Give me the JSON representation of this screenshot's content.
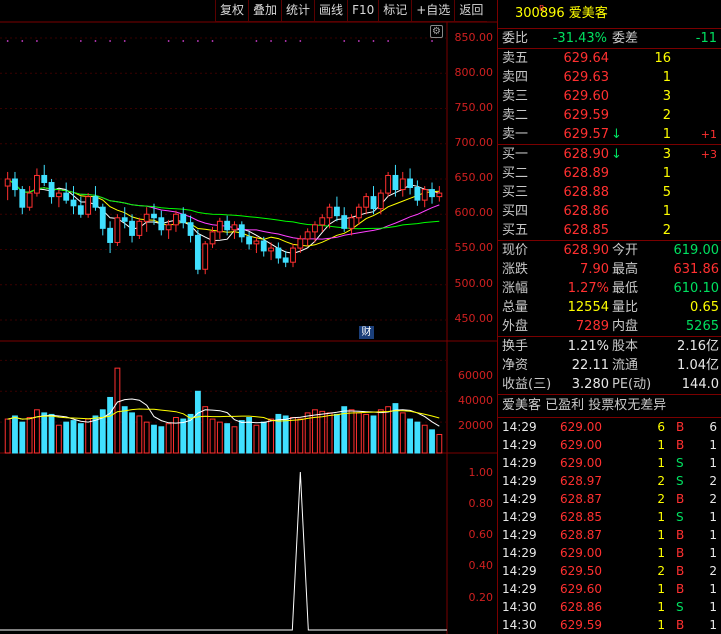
{
  "toolbar": [
    "复权",
    "叠加",
    "统计",
    "画线",
    "F10",
    "标记",
    "+自选",
    "返回"
  ],
  "price_axis": [
    "850.00",
    "800.00",
    "750.00",
    "700.00",
    "650.00",
    "600.00",
    "550.00",
    "500.00",
    "450.00"
  ],
  "volume_axis": [
    "60000",
    "40000",
    "20000"
  ],
  "indicator_axis": [
    "1.00",
    "0.80",
    "0.60",
    "0.40",
    "0.20"
  ],
  "event_badge": "财",
  "colors": {
    "up": "#ff3030",
    "down": "#40e0ff",
    "ma5": "#ffffff",
    "ma10": "#ffff00",
    "ma20": "#ff40ff",
    "ma60": "#00ff00",
    "frame": "#7a0000"
  },
  "candles": [
    [
      640,
      660,
      620,
      650
    ],
    [
      650,
      660,
      625,
      635
    ],
    [
      635,
      640,
      600,
      610
    ],
    [
      610,
      640,
      605,
      630
    ],
    [
      630,
      665,
      625,
      655
    ],
    [
      655,
      670,
      640,
      645
    ],
    [
      645,
      650,
      615,
      625
    ],
    [
      625,
      635,
      610,
      630
    ],
    [
      630,
      645,
      615,
      620
    ],
    [
      620,
      640,
      600,
      612
    ],
    [
      612,
      625,
      595,
      600
    ],
    [
      600,
      630,
      595,
      625
    ],
    [
      625,
      640,
      605,
      610
    ],
    [
      610,
      615,
      570,
      580
    ],
    [
      580,
      590,
      545,
      560
    ],
    [
      560,
      600,
      555,
      595
    ],
    [
      595,
      610,
      580,
      590
    ],
    [
      590,
      600,
      560,
      570
    ],
    [
      570,
      595,
      565,
      590
    ],
    [
      590,
      610,
      575,
      600
    ],
    [
      600,
      615,
      585,
      595
    ],
    [
      595,
      605,
      570,
      578
    ],
    [
      578,
      592,
      565,
      585
    ],
    [
      585,
      605,
      575,
      600
    ],
    [
      600,
      610,
      580,
      588
    ],
    [
      588,
      598,
      560,
      570
    ],
    [
      570,
      578,
      515,
      522
    ],
    [
      522,
      562,
      515,
      558
    ],
    [
      558,
      582,
      552,
      575
    ],
    [
      575,
      595,
      565,
      590
    ],
    [
      590,
      598,
      570,
      578
    ],
    [
      578,
      590,
      565,
      585
    ],
    [
      585,
      590,
      560,
      568
    ],
    [
      568,
      575,
      550,
      558
    ],
    [
      558,
      568,
      545,
      562
    ],
    [
      562,
      568,
      540,
      548
    ],
    [
      548,
      560,
      535,
      552
    ],
    [
      552,
      560,
      530,
      538
    ],
    [
      538,
      548,
      525,
      532
    ],
    [
      532,
      558,
      525,
      552
    ],
    [
      552,
      570,
      545,
      565
    ],
    [
      565,
      580,
      555,
      575
    ],
    [
      575,
      590,
      560,
      585
    ],
    [
      585,
      600,
      575,
      595
    ],
    [
      595,
      615,
      580,
      610
    ],
    [
      610,
      625,
      590,
      598
    ],
    [
      598,
      610,
      575,
      580
    ],
    [
      580,
      600,
      570,
      595
    ],
    [
      595,
      615,
      585,
      610
    ],
    [
      610,
      630,
      600,
      625
    ],
    [
      625,
      640,
      600,
      608
    ],
    [
      608,
      635,
      600,
      630
    ],
    [
      630,
      660,
      625,
      655
    ],
    [
      655,
      670,
      625,
      635
    ],
    [
      635,
      660,
      625,
      650
    ],
    [
      650,
      665,
      628,
      638
    ],
    [
      638,
      648,
      612,
      620
    ],
    [
      620,
      640,
      610,
      635
    ],
    [
      635,
      645,
      615,
      625
    ],
    [
      625,
      640,
      618,
      630
    ]
  ],
  "volumes": [
    22000,
    24000,
    20000,
    23000,
    28000,
    26000,
    25000,
    18000,
    20000,
    21000,
    19000,
    22000,
    24000,
    28000,
    36000,
    55000,
    30000,
    26000,
    24000,
    20000,
    18000,
    17000,
    19000,
    23000,
    22000,
    25000,
    40000,
    30000,
    22000,
    20000,
    19000,
    17000,
    21000,
    23000,
    18000,
    20000,
    22000,
    25000,
    24000,
    23000,
    22000,
    26000,
    28000,
    27000,
    26000,
    25000,
    30000,
    28000,
    26000,
    25000,
    24000,
    28000,
    30000,
    32000,
    26000,
    22000,
    20000,
    18000,
    15000,
    12000
  ],
  "indicator_peak": {
    "index": 40,
    "value": 1.0
  },
  "quote": {
    "code": "300896",
    "name": "爱美客",
    "badge": "R",
    "weibi_label": "委比",
    "weibi": "-31.43%",
    "weicha_label": "委差",
    "weicha": "-11",
    "asks": [
      {
        "label": "卖五",
        "price": "629.64",
        "vol": "16",
        "chg": ""
      },
      {
        "label": "卖四",
        "price": "629.63",
        "vol": "1",
        "chg": ""
      },
      {
        "label": "卖三",
        "price": "629.60",
        "vol": "3",
        "chg": ""
      },
      {
        "label": "卖二",
        "price": "629.59",
        "vol": "2",
        "chg": ""
      },
      {
        "label": "卖一",
        "price": "629.57",
        "vol": "1",
        "chg": "+1",
        "arrow": "↓"
      }
    ],
    "bids": [
      {
        "label": "买一",
        "price": "628.90",
        "vol": "3",
        "chg": "+3",
        "arrow": "↓"
      },
      {
        "label": "买二",
        "price": "628.89",
        "vol": "1",
        "chg": ""
      },
      {
        "label": "买三",
        "price": "628.88",
        "vol": "5",
        "chg": ""
      },
      {
        "label": "买四",
        "price": "628.86",
        "vol": "1",
        "chg": ""
      },
      {
        "label": "买五",
        "price": "628.85",
        "vol": "2",
        "chg": ""
      }
    ],
    "stats": [
      [
        {
          "l": "现价",
          "v": "628.90",
          "c": "red"
        },
        {
          "l": "今开",
          "v": "619.00",
          "c": "grn"
        }
      ],
      [
        {
          "l": "涨跌",
          "v": "7.90",
          "c": "red"
        },
        {
          "l": "最高",
          "v": "631.86",
          "c": "red"
        }
      ],
      [
        {
          "l": "涨幅",
          "v": "1.27%",
          "c": "red"
        },
        {
          "l": "最低",
          "v": "610.10",
          "c": "grn"
        }
      ],
      [
        {
          "l": "总量",
          "v": "12554",
          "c": "yel"
        },
        {
          "l": "量比",
          "v": "0.65",
          "c": "yel"
        }
      ],
      [
        {
          "l": "外盘",
          "v": "7289",
          "c": "red"
        },
        {
          "l": "内盘",
          "v": "5265",
          "c": "grn"
        }
      ]
    ],
    "stats2": [
      [
        {
          "l": "换手",
          "v": "1.21%",
          "c": "wht"
        },
        {
          "l": "股本",
          "v": "2.16亿",
          "c": "wht"
        }
      ],
      [
        {
          "l": "净资",
          "v": "22.11",
          "c": "wht"
        },
        {
          "l": "流通",
          "v": "1.04亿",
          "c": "wht"
        }
      ],
      [
        {
          "l": "收益(三)",
          "v": "3.280",
          "c": "wht"
        },
        {
          "l": "PE(动)",
          "v": "144.0",
          "c": "wht"
        }
      ]
    ],
    "tag_line": "爱美客 已盈利 投票权无差异",
    "ticks": [
      {
        "t": "14:29",
        "p": "629.00",
        "v": "6",
        "d": "B",
        "n": "6"
      },
      {
        "t": "14:29",
        "p": "629.00",
        "v": "1",
        "d": "B",
        "n": "1"
      },
      {
        "t": "14:29",
        "p": "629.00",
        "v": "1",
        "d": "S",
        "n": "1"
      },
      {
        "t": "14:29",
        "p": "628.97",
        "v": "2",
        "d": "S",
        "n": "2"
      },
      {
        "t": "14:29",
        "p": "628.87",
        "v": "2",
        "d": "B",
        "n": "2"
      },
      {
        "t": "14:29",
        "p": "628.85",
        "v": "1",
        "d": "S",
        "n": "1"
      },
      {
        "t": "14:29",
        "p": "628.87",
        "v": "1",
        "d": "B",
        "n": "1"
      },
      {
        "t": "14:29",
        "p": "629.00",
        "v": "1",
        "d": "B",
        "n": "1"
      },
      {
        "t": "14:29",
        "p": "629.50",
        "v": "2",
        "d": "B",
        "n": "2"
      },
      {
        "t": "14:29",
        "p": "629.60",
        "v": "1",
        "d": "B",
        "n": "1"
      },
      {
        "t": "14:30",
        "p": "628.86",
        "v": "1",
        "d": "S",
        "n": "1"
      },
      {
        "t": "14:30",
        "p": "629.59",
        "v": "1",
        "d": "B",
        "n": "1"
      }
    ]
  }
}
